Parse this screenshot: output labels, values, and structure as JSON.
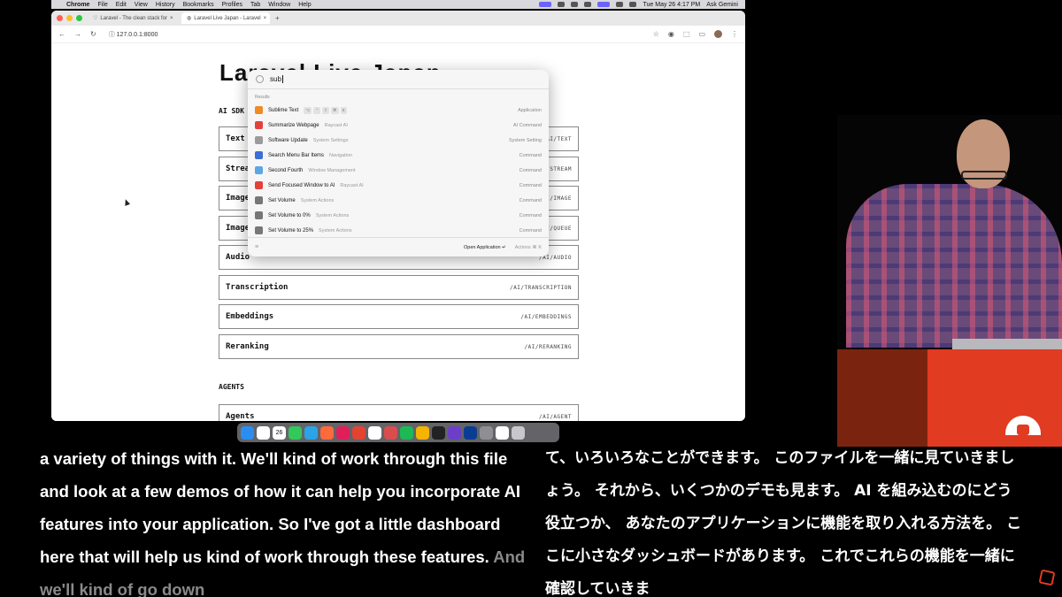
{
  "menubar": {
    "app": "Chrome",
    "items": [
      "File",
      "Edit",
      "View",
      "History",
      "Bookmarks",
      "Profiles",
      "Tab",
      "Window",
      "Help"
    ],
    "clock": "Tue May 26  4:17 PM",
    "ask": "Ask Gemini"
  },
  "browser": {
    "tabs": [
      {
        "title": "Laravel - The clean stack for"
      },
      {
        "title": "Laravel Live Japan - Laravel"
      }
    ],
    "url": "127.0.0.1:8000"
  },
  "page": {
    "title": "Laravel Live Japan",
    "sections": [
      {
        "label": "AI SDK"
      },
      {
        "label": "AGENTS"
      }
    ],
    "rows": [
      {
        "name": "Text",
        "path": "/AI/TEXT"
      },
      {
        "name": "Stream",
        "path": "/AI/STREAM"
      },
      {
        "name": "Image",
        "path": "/AI/IMAGE"
      },
      {
        "name": "Image",
        "path": "/AI/IMAGE/QUEUE"
      },
      {
        "name": "Audio",
        "path": "/AI/AUDIO"
      },
      {
        "name": "Transcription",
        "path": "/AI/TRANSCRIPTION"
      },
      {
        "name": "Embeddings",
        "path": "/AI/EMBEDDINGS"
      },
      {
        "name": "Reranking",
        "path": "/AI/RERANKING"
      },
      {
        "name": "Agents",
        "path": "/AI/AGENT"
      }
    ]
  },
  "raycast": {
    "query": "sub",
    "results_label": "Results",
    "items": [
      {
        "title": "Sublime Text",
        "subtitle": "",
        "type": "Application",
        "color": "#f08a24"
      },
      {
        "title": "Summarize Webpage",
        "subtitle": "Raycast AI",
        "type": "AI Command",
        "color": "#e4413a"
      },
      {
        "title": "Software Update",
        "subtitle": "System Settings",
        "type": "System Setting",
        "color": "#9b9b9b"
      },
      {
        "title": "Search Menu Bar Items",
        "subtitle": "Navigation",
        "type": "Command",
        "color": "#3a6fd8"
      },
      {
        "title": "Second Fourth",
        "subtitle": "Window Management",
        "type": "Command",
        "color": "#5aa7e6"
      },
      {
        "title": "Send Focused Window to AI",
        "subtitle": "Raycast AI",
        "type": "Command",
        "color": "#e4413a"
      },
      {
        "title": "Set Volume",
        "subtitle": "System Actions",
        "type": "Command",
        "color": "#777777"
      },
      {
        "title": "Set Volume to 0%",
        "subtitle": "System Actions",
        "type": "Command",
        "color": "#777777"
      },
      {
        "title": "Set Volume to 25%",
        "subtitle": "System Actions",
        "type": "Command",
        "color": "#777777"
      }
    ],
    "footer": {
      "primary": "Open Application",
      "secondary": "Actions"
    }
  },
  "dock": {
    "icons": [
      "finder-icon",
      "chrome-icon",
      "calendar-icon",
      "messages-icon",
      "telegram-icon",
      "raycast-icon",
      "slack-icon",
      "todoist-icon",
      "notion-icon",
      "craft-icon",
      "spotify-icon",
      "bolt-icon",
      "github-icon",
      "screenflow-icon",
      "onepassword-icon",
      "settings-icon",
      "preview-icon",
      "trash-icon"
    ],
    "calendar_day": "26",
    "colors": [
      "#2a8ef0",
      "#ffffff",
      "#ffffff",
      "#34c759",
      "#2aa3e8",
      "#ff6a3d",
      "#e01e5a",
      "#e44332",
      "#ffffff",
      "#d94d4d",
      "#1db954",
      "#f5b400",
      "#222222",
      "#6b3fc9",
      "#0a3d91",
      "#8e8e93",
      "#ffffff",
      "#c7c7cc"
    ]
  },
  "captions": {
    "en_main": "a variety of things with it. We'll kind of work through this file and look at a few demos of how it can help you incorporate AI features into your application. So I've got a little dashboard here that will help us kind of work through these features.",
    "en_dim": "And we'll kind of go down",
    "jp": "て、いろいろなことができます。 このファイルを一緒に見ていきましょう。 それから、いくつかのデモも見ます。 AI を組み込むのにどう役立つか、 あなたのアプリケーションに機能を取り入れる方法を。 ここに小さなダッシュボードがあります。 これでこれらの機能を一緒に確認していきま"
  }
}
